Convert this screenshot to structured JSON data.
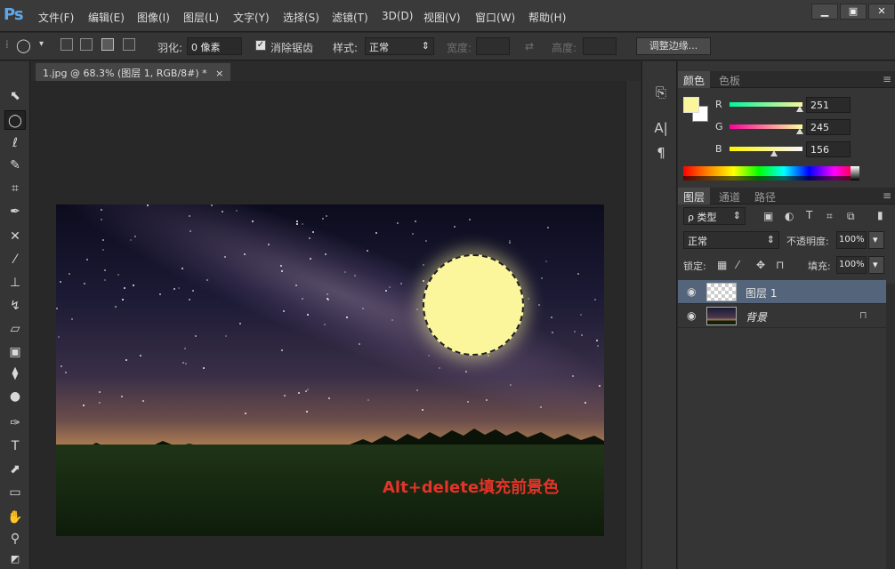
{
  "app": {
    "logo": "Ps"
  },
  "menu": [
    "文件(F)",
    "编辑(E)",
    "图像(I)",
    "图层(L)",
    "文字(Y)",
    "选择(S)",
    "滤镜(T)",
    "3D(D)",
    "视图(V)",
    "窗口(W)",
    "帮助(H)"
  ],
  "window_controls": {
    "minimize": "▁",
    "maximize": "▣",
    "close": "✕"
  },
  "options": {
    "feather_label": "羽化:",
    "feather_value": "0 像素",
    "antialias_label": "消除锯齿",
    "antialias_checked": true,
    "style_label": "样式:",
    "style_value": "正常",
    "width_label": "宽度:",
    "height_label": "高度:",
    "swap_icon": "⇄",
    "refine_edge": "调整边缘..."
  },
  "document": {
    "tab_title": "1.jpg @ 68.3% (图层 1, RGB/8#) *",
    "tab_close": "×",
    "annotation": "Alt+delete填充前景色"
  },
  "color_panel": {
    "tabs": [
      "颜色",
      "色板"
    ],
    "active_tab": "颜色",
    "foreground": "#fbf59c",
    "background": "#ffffff",
    "channels": [
      {
        "label": "R",
        "value": "251"
      },
      {
        "label": "G",
        "value": "245"
      },
      {
        "label": "B",
        "value": "156"
      }
    ]
  },
  "layers_panel": {
    "tabs": [
      "图层",
      "通道",
      "路径"
    ],
    "active_tab": "图层",
    "filter_label": "ρ 类型",
    "blend_mode": "正常",
    "opacity_label": "不透明度:",
    "opacity_value": "100%",
    "lock_label": "锁定:",
    "fill_label": "填充:",
    "fill_value": "100%",
    "layers": [
      {
        "name": "图层 1",
        "selected": true,
        "visible": true,
        "locked": false
      },
      {
        "name": "背景",
        "selected": false,
        "visible": true,
        "locked": true
      }
    ]
  },
  "icons": {
    "eye": "◉",
    "lock": "🔒",
    "chevron_down": "▾",
    "spinner": "⇕"
  }
}
